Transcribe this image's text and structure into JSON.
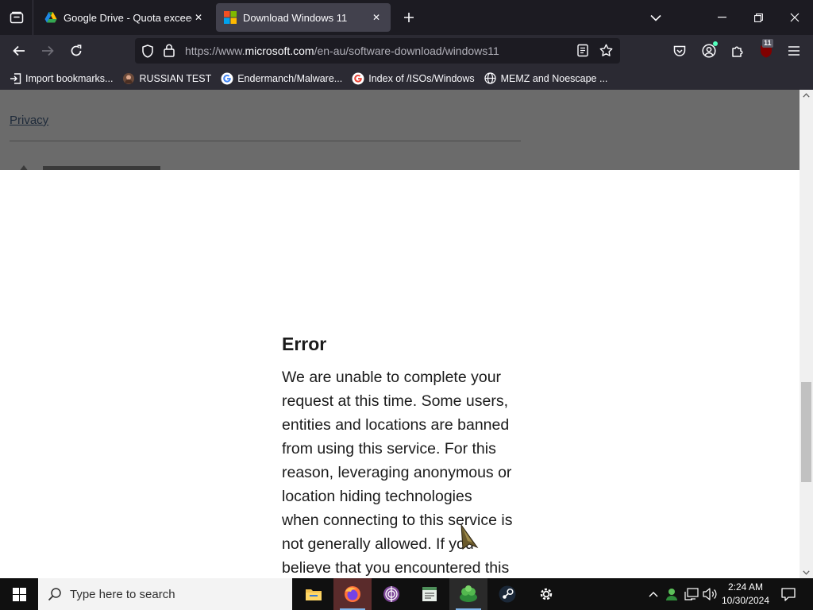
{
  "browser": {
    "tabs": [
      {
        "title": "Google Drive - Quota exceeded",
        "favicon": "google-drive-icon",
        "active": false
      },
      {
        "title": "Download Windows 11",
        "favicon": "microsoft-logo-icon",
        "active": true
      }
    ],
    "url": {
      "prefix": "https://www.",
      "domain": "microsoft.com",
      "path": "/en-au/software-download/windows11"
    },
    "extension_badge": "11",
    "bookmarks": [
      {
        "label": "Import bookmarks...",
        "icon": "import-icon"
      },
      {
        "label": "RUSSIAN TEST",
        "icon": "site-icon"
      },
      {
        "label": "Endermanch/Malware...",
        "icon": "google-icon"
      },
      {
        "label": "Index of /ISOs/Windows",
        "icon": "google-icon"
      },
      {
        "label": "MEMZ and Noescape ...",
        "icon": "globe-icon"
      }
    ]
  },
  "page": {
    "overlay_link": "Privacy",
    "error": {
      "heading": "Error",
      "lines": [
        "We are unable to complete your",
        "request at this time. Some users,",
        "entities and locations are banned",
        "from using this service. For this",
        "reason, leveraging anonymous or",
        "location hiding technologies",
        "when connecting to this service is",
        "not generally allowed. If you",
        "believe that you encountered this"
      ]
    },
    "scroll_position": 0.74
  },
  "taskbar": {
    "search_placeholder": "Type here to search",
    "apps": [
      "file-explorer-icon",
      "firefox-icon",
      "tor-browser-icon",
      "notepad-icon",
      "game-icon",
      "steam-icon",
      "settings-icon"
    ],
    "time": "2:24 AM",
    "date": "10/30/2024"
  },
  "colors": {
    "tabbar_bg": "#1c1b22",
    "toolbar_bg": "#2b2a33",
    "overlay_bg": "#6b6b6b",
    "taskbar_bg": "#101010"
  }
}
